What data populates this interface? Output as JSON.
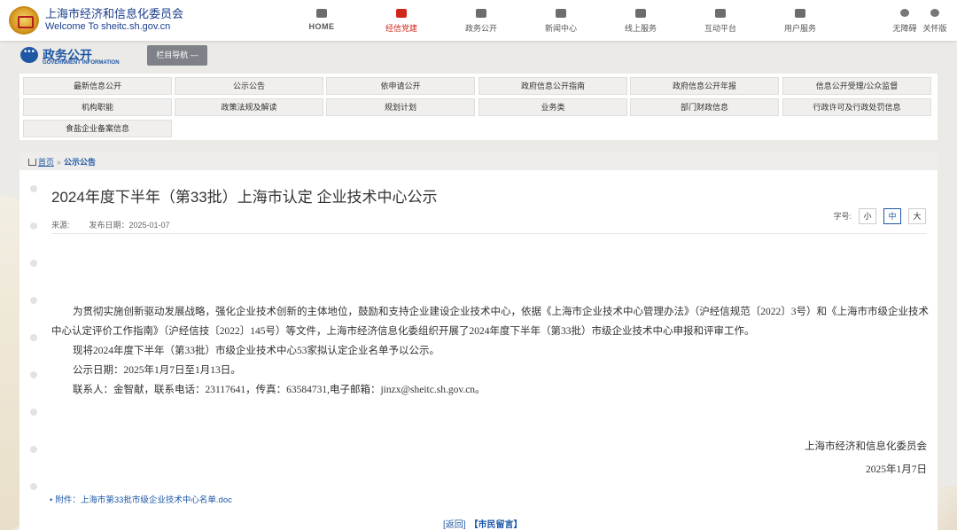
{
  "header": {
    "title": "上海市经济和信息化委员会",
    "subtitle": "Welcome To sheitc.sh.gov.cn",
    "nav": [
      {
        "label": "HOME",
        "icon": "home-icon"
      },
      {
        "label": "经信党建",
        "icon": "party-emblem-icon"
      },
      {
        "label": "政务公开",
        "icon": "chat-bubble-icon"
      },
      {
        "label": "新闻中心",
        "icon": "news-icon"
      },
      {
        "label": "线上服务",
        "icon": "users-icon"
      },
      {
        "label": "互动平台",
        "icon": "grid-icon"
      },
      {
        "label": "用户服务",
        "icon": "gear-icon"
      }
    ],
    "active_nav": "经信党建",
    "accessibility": [
      {
        "label": "无障碍",
        "icon": "accessibility-icon"
      },
      {
        "label": "关怀版",
        "icon": "care-icon"
      }
    ]
  },
  "section": {
    "title": "政务公开",
    "title_en": "GOVERNMENT INFORMATION",
    "column_nav": "栏目导航 —"
  },
  "categories": [
    "最新信息公开",
    "公示公告",
    "依申请公开",
    "政府信息公开指南",
    "政府信息公开年报",
    "信息公开受理/公众监督",
    "机构职能",
    "政策法规及解读",
    "规划计划",
    "业务类",
    "部门财政信息",
    "行政许可及行政处罚信息",
    "食盐企业备案信息"
  ],
  "breadcrumb": {
    "home": "首页",
    "separator": "»",
    "current": "公示公告"
  },
  "article": {
    "title": "2024年度下半年（第33批）上海市认定 企业技术中心公示",
    "source_label": "来源:",
    "date_label": "发布日期：2025-01-07",
    "font_size_label": "字号:",
    "font_sizes": [
      "小",
      "中",
      "大"
    ],
    "active_font_size": "中",
    "paragraphs": [
      "为贯彻实施创新驱动发展战略，强化企业技术创新的主体地位，鼓励和支持企业建设企业技术中心，依据《上海市企业技术中心管理办法》（沪经信规范〔2022〕3号）和《上海市市级企业技术中心认定评价工作指南》（沪经信技〔2022〕145号）等文件，上海市经济信息化委组织开展了2024年度下半年（第33批）市级企业技术中心申报和评审工作。",
      "现将2024年度下半年（第33批）市级企业技术中心53家拟认定企业名单予以公示。",
      "公示日期：2025年1月7日至1月13日。",
      "联系人：金智献，联系电话：23117641，传真：63584731,电子邮箱：jinzx@sheitc.sh.gov.cn。"
    ],
    "signature_org": "上海市经济和信息化委员会",
    "signature_date": "2025年1月7日",
    "attachment": "附件：上海市第33批市级企业技术中心名单.doc",
    "back_link": "[返回]",
    "message_link": "【市民留言】"
  },
  "colors": {
    "brand_blue": "#1d57a6",
    "active_red": "#d0271d",
    "page_bg": "#eceae6"
  }
}
